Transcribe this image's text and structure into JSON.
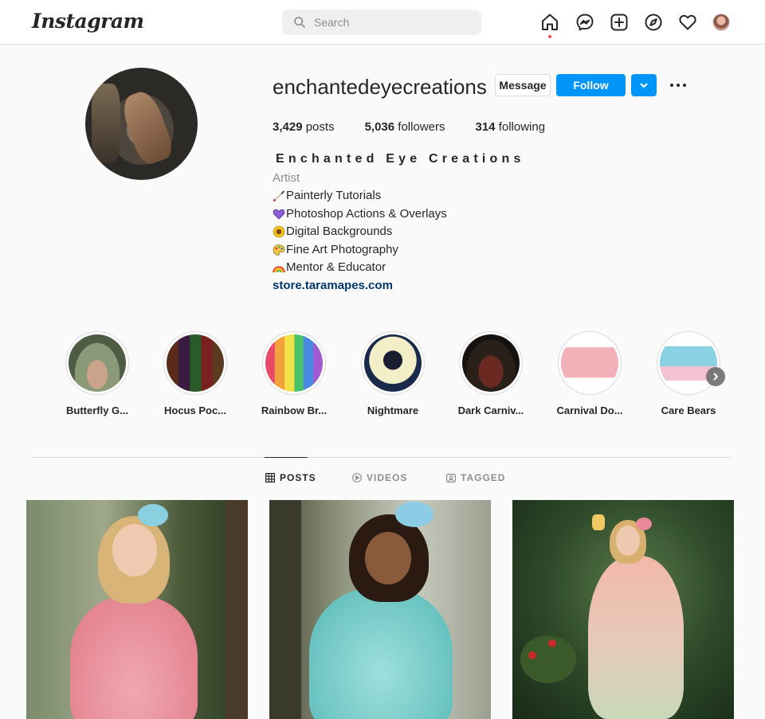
{
  "topnav": {
    "logo": "Instagram",
    "search_placeholder": "Search",
    "icons": [
      "home-icon",
      "messenger-icon",
      "new-post-icon",
      "explore-icon",
      "activity-heart-icon",
      "profile-avatar"
    ]
  },
  "profile": {
    "username": "enchantedeyecreations",
    "buttons": {
      "message": "Message",
      "follow": "Follow"
    },
    "stats": {
      "posts_count": "3,429",
      "posts_label": "posts",
      "followers_count": "5,036",
      "followers_label": "followers",
      "following_count": "314",
      "following_label": "following"
    },
    "full_name": "Enchanted Eye Creations",
    "category": "Artist",
    "bio": [
      {
        "emoji": "paintbrush-icon",
        "text": "Painterly Tutorials"
      },
      {
        "emoji": "purple-heart-icon",
        "text": "Photoshop Actions & Overlays"
      },
      {
        "emoji": "sunflower-icon",
        "text": "Digital Backgrounds"
      },
      {
        "emoji": "palette-icon",
        "text": " Fine Art Photography"
      },
      {
        "emoji": "rainbow-icon",
        "text": " Mentor & Educator"
      }
    ],
    "link": "store.taramapes.com"
  },
  "highlights": [
    {
      "label": "Butterfly G..."
    },
    {
      "label": "Hocus Poc..."
    },
    {
      "label": "Rainbow Br..."
    },
    {
      "label": "Nightmare"
    },
    {
      "label": "Dark Carniv..."
    },
    {
      "label": "Carnival Do..."
    },
    {
      "label": "Care Bears"
    }
  ],
  "tabs": [
    {
      "label": "POSTS",
      "icon": "grid-icon",
      "active": true
    },
    {
      "label": "VIDEOS",
      "icon": "video-icon",
      "active": false
    },
    {
      "label": "TAGGED",
      "icon": "tagged-icon",
      "active": false
    }
  ],
  "colors": {
    "accent_blue": "#0095f6",
    "link_blue": "#00376b",
    "text": "#262626",
    "muted": "#8e8e8e",
    "border": "#dbdbdb",
    "notification_dot": "#ed4956"
  }
}
